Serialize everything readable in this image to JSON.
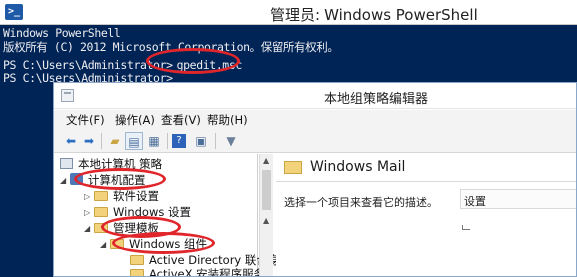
{
  "powershell": {
    "title_zh": "管理员:",
    "title_en": "Windows PowerShell",
    "icon": "powershell-icon",
    "lines": [
      "Windows PowerShell",
      "版权所有 (C) 2012 Microsoft Corporation。保留所有权利。",
      "PS C:\\Users\\Administrator>",
      "PS C:\\Users\\Administrator>"
    ],
    "command": "gpedit.msc",
    "background": "#012456",
    "highlight_color": "#e0262a"
  },
  "gpedit": {
    "title": "本地组策略编辑器",
    "menu": [
      "文件(F)",
      "操作(A)",
      "查看(V)",
      "帮助(H)"
    ],
    "toolbar": {
      "icons": [
        "back-arrow-icon",
        "forward-arrow-icon",
        "folder-up-icon",
        "show-hide-tree-icon",
        "export-list-icon",
        "help-icon",
        "properties-icon",
        "filter-icon"
      ]
    },
    "tree": {
      "root": "本地计算机 策略",
      "computer_config": "计算机配置",
      "software_settings": "软件设置",
      "windows_settings": "Windows 设置",
      "admin_templates": "管理模板",
      "windows_components": "Windows 组件",
      "active_directory": "Active Directory 联合身份",
      "activex": "ActiveX 安装程序服务"
    },
    "detail": {
      "title": "Windows Mail",
      "description": "选择一个项目来查看它的描述。",
      "column_header": "设置"
    }
  }
}
